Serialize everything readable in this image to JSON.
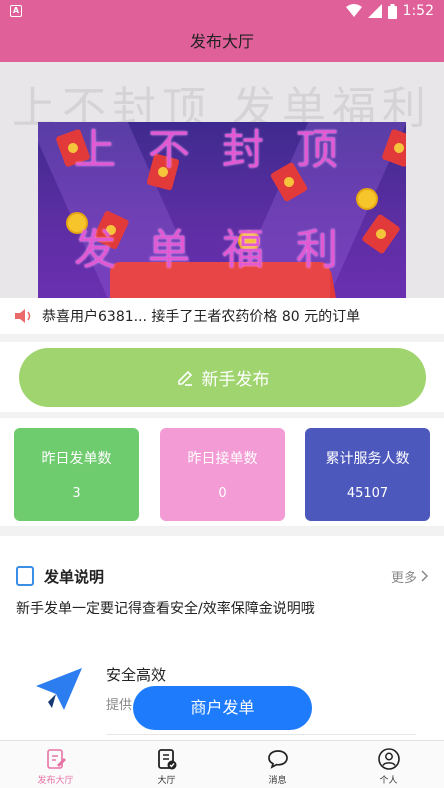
{
  "status_bar": {
    "time": "1:52",
    "app_indicator": "A"
  },
  "header": {
    "title": "发布大厅"
  },
  "banner": {
    "background_text": "上不封顶 发单福利",
    "line1": "上不封顶",
    "line2": "发单福利",
    "slide_count": 2,
    "active_slide": 1
  },
  "notice": {
    "text": "恭喜用户6381... 接手了王者农药价格 80 元的订单"
  },
  "publish_button": {
    "label": "新手发布"
  },
  "stats": [
    {
      "label": "昨日发单数",
      "value": "3",
      "color": "#6ecb6e"
    },
    {
      "label": "昨日接单数",
      "value": "0",
      "color": "#f29bd4"
    },
    {
      "label": "累计服务人数",
      "value": "45107",
      "color": "#4d58bd"
    }
  ],
  "section": {
    "title": "发单说明",
    "more_label": "更多",
    "description": "新手发单一定要记得查看安全/效率保障金说明哦"
  },
  "feature": {
    "title": "安全高效",
    "subtitle": "提供"
  },
  "merchant_button": {
    "label": "商户发单"
  },
  "tabs": [
    {
      "label": "发布大厅",
      "icon": "edit-doc-icon",
      "active": true
    },
    {
      "label": "大厅",
      "icon": "checklist-icon",
      "active": false
    },
    {
      "label": "消息",
      "icon": "chat-bubble-icon",
      "active": false
    },
    {
      "label": "个人",
      "icon": "user-icon",
      "active": false
    }
  ],
  "colors": {
    "header": "#e0619a",
    "publish": "#9fd46e",
    "merchant": "#1e7bfb",
    "accent": "#3a8ee6"
  }
}
